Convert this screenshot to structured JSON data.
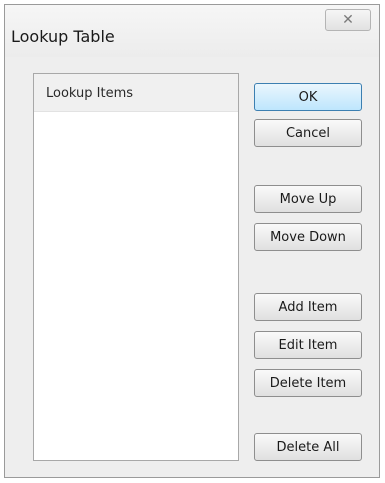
{
  "window": {
    "title": "Lookup Table",
    "close_icon": "close-icon",
    "close_glyph": "✕"
  },
  "list": {
    "header": "Lookup Items",
    "items": []
  },
  "buttons": {
    "ok": "OK",
    "cancel": "Cancel",
    "move_up": "Move Up",
    "move_down": "Move Down",
    "add_item": "Add Item",
    "edit_item": "Edit Item",
    "delete_item": "Delete Item",
    "delete_all": "Delete All"
  },
  "colors": {
    "default_button_border": "#3c7fb1",
    "default_button_fill": "#bee6fd"
  }
}
